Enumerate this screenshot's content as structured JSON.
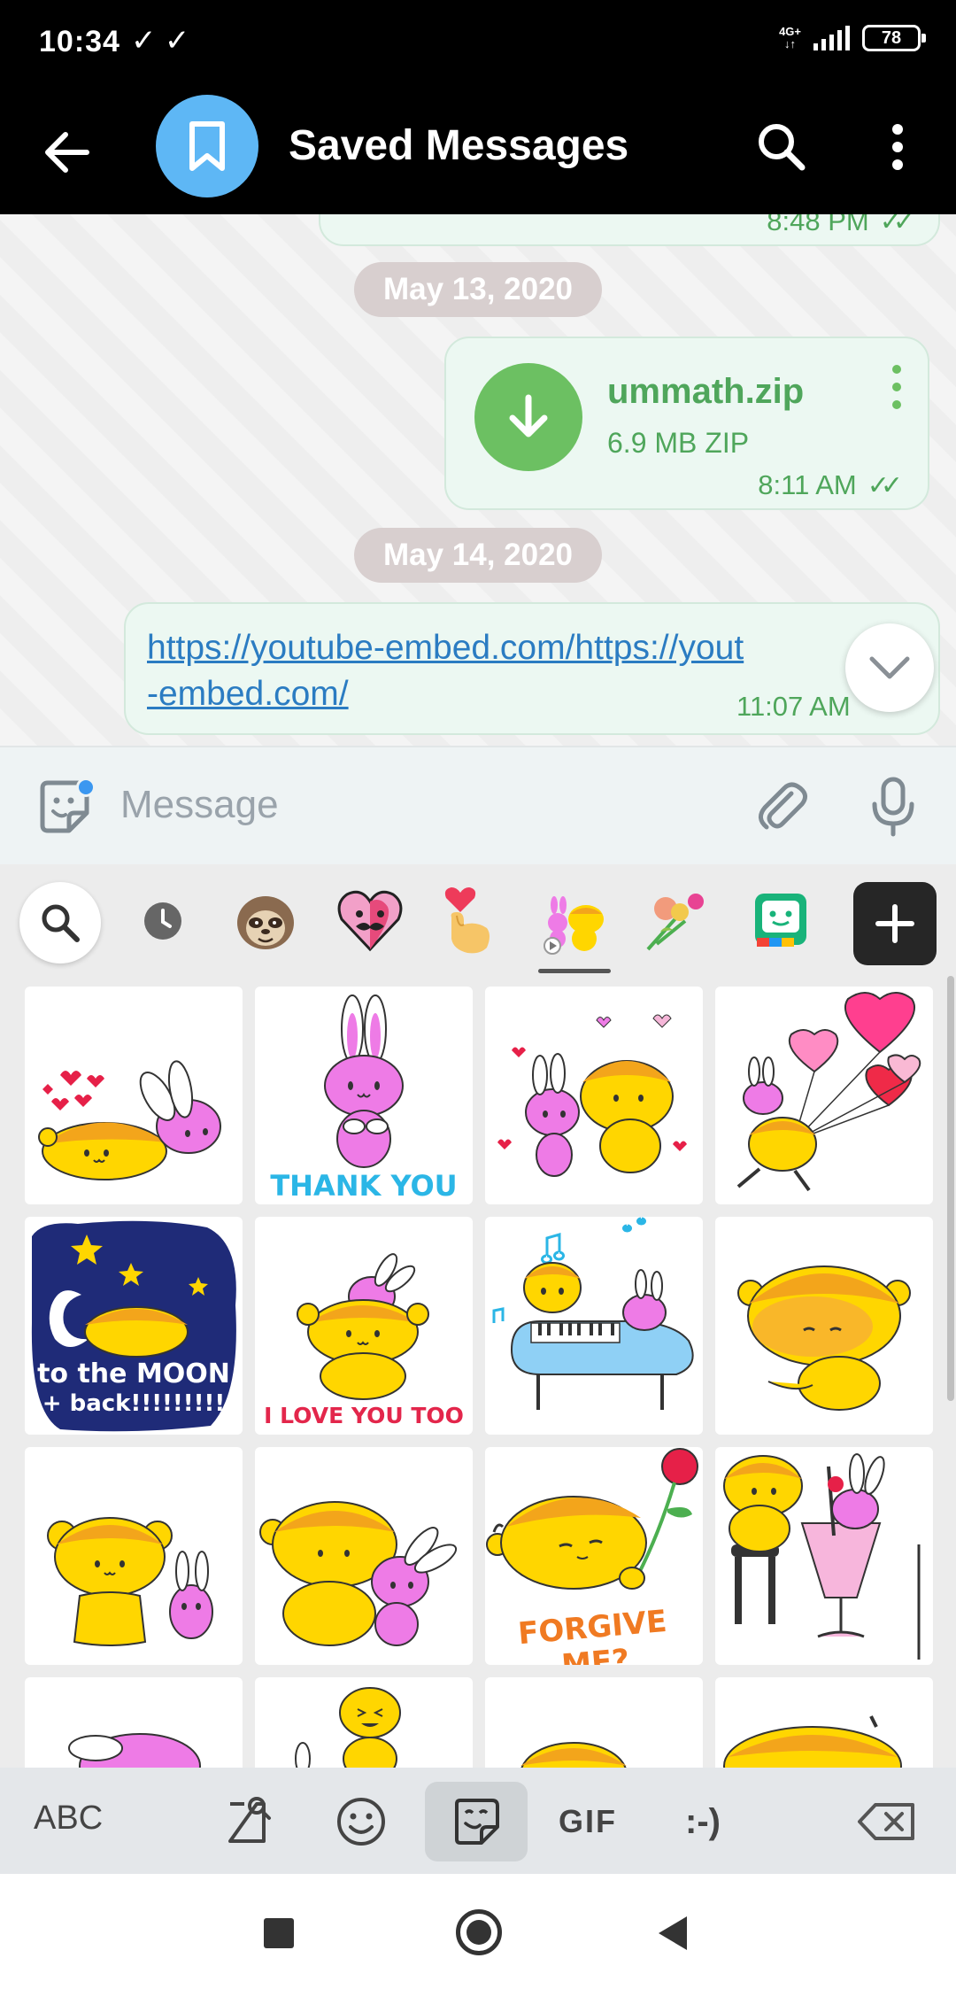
{
  "status_bar": {
    "time": "10:34",
    "checks": "✓ ✓",
    "network_line1": "4G+",
    "network_line2": "↓↑",
    "battery": "78"
  },
  "header": {
    "title": "Saved Messages"
  },
  "chat": {
    "top_time": "8:48 PM",
    "dates": [
      "May 13, 2020",
      "May 14, 2020"
    ],
    "file_message": {
      "name": "ummath.zip",
      "size": "6.9 MB ZIP",
      "time": "8:11 AM"
    },
    "link_message": {
      "line1": "https://youtube-embed.com/https://yout",
      "line2": "-embed.com/",
      "time": "11:07 AM"
    }
  },
  "input": {
    "placeholder": "Message"
  },
  "sticker_panel": {
    "tabs": [
      "search",
      "recent",
      "sloth",
      "heart-mustache",
      "heart-hand",
      "cat-bunny",
      "bouquet",
      "bot-face"
    ],
    "captions": {
      "thank_you": "THANK YOU",
      "moon_line1": "to the MOON",
      "moon_line2": "+ back!!!!!!!!!",
      "love_you_too": "I LOVE YOU TOO",
      "forgive_me": "FORGIVE ME?"
    },
    "colors": {
      "bear": "#ffd600",
      "bear_top": "#f3a51b",
      "bunny": "#ee7be6",
      "heart": "#e62048",
      "pink_balloon": "#ff6fae",
      "moon_bg": "#1f2b78",
      "thank_you_text": "#2bb6e6",
      "love_text": "#e3264b",
      "forgive_text": "#f07a22",
      "piano": "#8fd0f5"
    }
  },
  "keyboard_toolbar": {
    "abc": "ABC",
    "gif": "GIF",
    "emoticon": ":-)"
  }
}
